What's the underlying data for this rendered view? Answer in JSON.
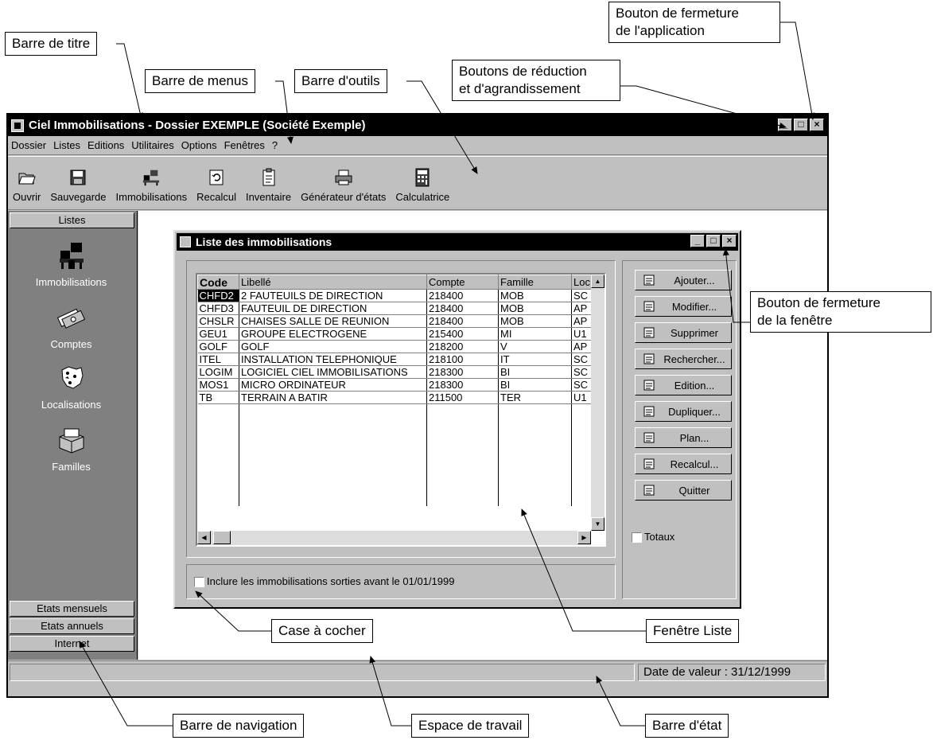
{
  "app": {
    "title": "Ciel Immobilisations - Dossier EXEMPLE (Société Exemple)",
    "window_buttons": [
      "_",
      "□",
      "×"
    ]
  },
  "menu": [
    "Dossier",
    "Listes",
    "Editions",
    "Utilitaires",
    "Options",
    "Fenêtres",
    "?"
  ],
  "toolbar": [
    "Ouvrir",
    "Sauvegarde",
    "Immobilisations",
    "Recalcul",
    "Inventaire",
    "Générateur d'états",
    "Calculatrice"
  ],
  "nav": {
    "header": "Listes",
    "items": [
      "Immobilisations",
      "Comptes",
      "Localisations",
      "Familles"
    ],
    "bottom": [
      "Etats mensuels",
      "Etats annuels",
      "Internet"
    ]
  },
  "list_window": {
    "title": "Liste des immobilisations",
    "columns": [
      "Code",
      "Libellé",
      "Compte",
      "Famille",
      "Loc"
    ],
    "rows": [
      [
        "CHFD2",
        "2 FAUTEUILS DE DIRECTION",
        "218400",
        "MOB",
        "SC"
      ],
      [
        "CHFD3",
        "FAUTEUIL DE DIRECTION",
        "218400",
        "MOB",
        "AP"
      ],
      [
        "CHSLR",
        "CHAISES SALLE DE REUNION",
        "218400",
        "MOB",
        "AP"
      ],
      [
        "GEU1",
        "GROUPE ELECTROGENE",
        "215400",
        "MI",
        "U1"
      ],
      [
        "GOLF",
        "GOLF",
        "218200",
        "V",
        "AP"
      ],
      [
        "ITEL",
        "INSTALLATION TELEPHONIQUE",
        "218100",
        "IT",
        "SC"
      ],
      [
        "LOGIM",
        "LOGICIEL CIEL IMMOBILISATIONS",
        "218300",
        "BI",
        "SC"
      ],
      [
        "MOS1",
        "MICRO ORDINATEUR",
        "218300",
        "BI",
        "SC"
      ],
      [
        "TB",
        "TERRAIN A BATIR",
        "211500",
        "TER",
        "U1"
      ]
    ],
    "buttons": [
      "Ajouter...",
      "Modifier...",
      "Supprimer",
      "Rechercher...",
      "Edition...",
      "Dupliquer...",
      "Plan...",
      "Recalcul...",
      "Quitter"
    ],
    "totaux_label": "Totaux",
    "include_label": "Inclure les immobilisations sorties avant le 01/01/1999"
  },
  "status": {
    "date": "Date de valeur : 31/12/1999"
  },
  "callouts": {
    "titre": "Barre de titre",
    "menus": "Barre de menus",
    "outils": "Barre d'outils",
    "reduction_1": "Boutons de réduction",
    "reduction_2": "et d'agrandissement",
    "fermeture_app_1": "Bouton de fermeture",
    "fermeture_app_2": "de l'application",
    "fermeture_fen_1": "Bouton de fermeture",
    "fermeture_fen_2": "de la fenêtre",
    "case": "Case à cocher",
    "fenetre_liste": "Fenêtre Liste",
    "navigation": "Barre de navigation",
    "espace": "Espace de travail",
    "etat": "Barre d'état"
  }
}
